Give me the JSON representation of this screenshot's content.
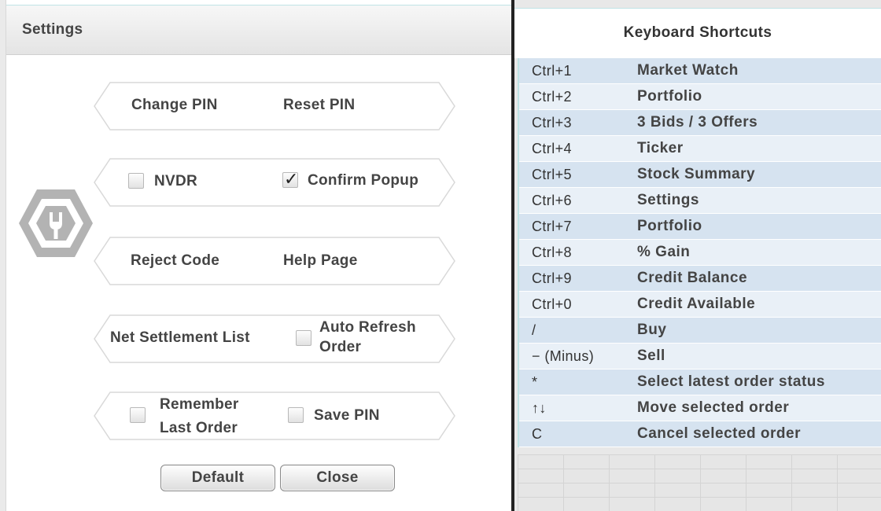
{
  "settings": {
    "title": "Settings",
    "buttons": {
      "change_pin": "Change PIN",
      "reset_pin": "Reset PIN",
      "reject_code": "Reject Code",
      "help_page": "Help Page",
      "net_settlement": "Net Settlement List",
      "default": "Default",
      "close": "Close"
    },
    "checkboxes": {
      "nvdr": {
        "label": "NVDR",
        "checked": false
      },
      "confirm_popup": {
        "label": "Confirm Popup",
        "checked": true
      },
      "auto_refresh_line1": "Auto Refresh",
      "auto_refresh_line2": "Order",
      "auto_refresh_checked": false,
      "remember_line1": "Remember",
      "remember_line2": "Last Order",
      "remember_checked": false,
      "save_pin": {
        "label": "Save PIN",
        "checked": false
      }
    },
    "logo_icon": "wrench-hexagon-icon"
  },
  "shortcuts": {
    "title": "Keyboard Shortcuts",
    "rows": [
      {
        "key": "Ctrl+1",
        "desc": "Market Watch"
      },
      {
        "key": "Ctrl+2",
        "desc": "Portfolio"
      },
      {
        "key": "Ctrl+3",
        "desc": "3 Bids / 3 Offers"
      },
      {
        "key": "Ctrl+4",
        "desc": "Ticker"
      },
      {
        "key": "Ctrl+5",
        "desc": "Stock Summary"
      },
      {
        "key": "Ctrl+6",
        "desc": "Settings"
      },
      {
        "key": "Ctrl+7",
        "desc": "Portfolio"
      },
      {
        "key": "Ctrl+8",
        "desc": "% Gain"
      },
      {
        "key": "Ctrl+9",
        "desc": "Credit Balance"
      },
      {
        "key": "Ctrl+0",
        "desc": "Credit Available"
      },
      {
        "key": "/",
        "desc": "Buy"
      },
      {
        "key": "− (Minus)",
        "desc": "Sell"
      },
      {
        "key": "*",
        "desc": "Select latest order status"
      },
      {
        "key": "↑↓",
        "desc": "Move selected order"
      },
      {
        "key": "C",
        "desc": "Cancel selected order"
      }
    ]
  },
  "colors": {
    "row_odd": "#d6e3f0",
    "row_even": "#e9f0f7",
    "accent_border": "#bfe3e5"
  }
}
